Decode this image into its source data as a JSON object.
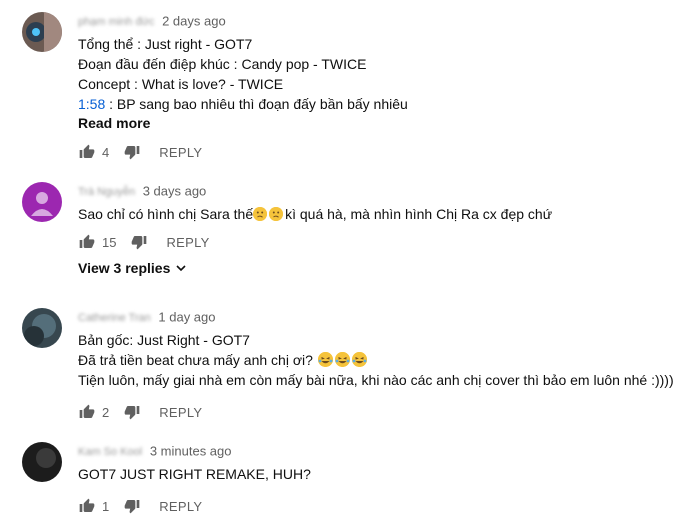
{
  "comments": [
    {
      "author": "phạm minh đức",
      "time": "2 days ago",
      "lines": [
        "Tổng thể : Just right - GOT7",
        "Đoạn đầu đến điệp khúc : Candy pop - TWICE",
        "Concept : What is love? - TWICE"
      ],
      "timestamp_link": "1:58",
      "timestamp_rest": " : BP sang bao nhiêu thì đoạn đấy bần bấy nhiêu",
      "read_more": "Read more",
      "likes": "4",
      "reply_label": "REPLY",
      "avatar_color": "#8d6e63"
    },
    {
      "author": "Trà Nguyễn",
      "time": "3 days ago",
      "text_before": "Sao chỉ có hình chị Sara thế",
      "text_after": "kì quá hà, mà nhìn hình Chị Ra cx đẹp chứ",
      "likes": "15",
      "reply_label": "REPLY",
      "view_replies": "View 3 replies",
      "avatar_color": "#9c27b0"
    },
    {
      "author": "Catherine Tran",
      "time": "1 day ago",
      "line1": "Bản gốc: Just Right - GOT7",
      "line2": "Đã trả tiền beat chưa mấy anh chị ơi? ",
      "line3": "Tiện luôn, mấy giai nhà em còn mấy bài nữa, khi nào các anh chị cover thì bảo em luôn nhé :))))",
      "likes": "2",
      "reply_label": "REPLY",
      "avatar_color": "#37474f"
    },
    {
      "author": "Kam So Kool",
      "time": "3 minutes ago",
      "text": "GOT7 JUST RIGHT REMAKE, HUH?",
      "likes": "1",
      "reply_label": "REPLY",
      "avatar_color": "#212121"
    }
  ],
  "icons": {
    "like": "thumbs-up-icon",
    "dislike": "thumbs-down-icon",
    "chevron": "chevron-down-icon",
    "confused_emoji": "confused-face-emoji",
    "laugh_emoji": "tears-of-joy-emoji"
  }
}
